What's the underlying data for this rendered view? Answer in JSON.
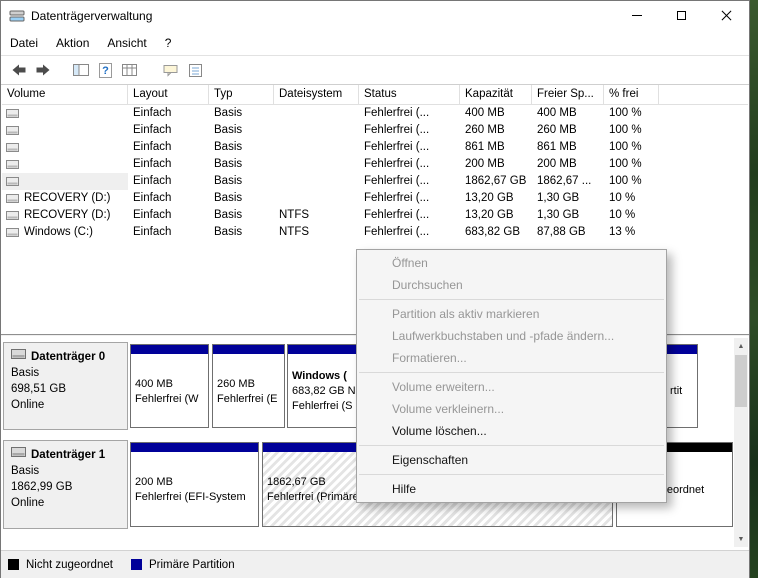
{
  "window": {
    "title": "Datenträgerverwaltung",
    "controls": [
      "minimize",
      "maximize",
      "close"
    ]
  },
  "menubar": [
    "Datei",
    "Aktion",
    "Ansicht",
    "?"
  ],
  "toolbar": {
    "icons": [
      "back",
      "forward",
      "console-tree",
      "help",
      "list-view",
      "action-pane",
      "properties"
    ]
  },
  "table": {
    "columns": [
      "Volume",
      "Layout",
      "Typ",
      "Dateisystem",
      "Status",
      "Kapazität",
      "Freier Sp...",
      "% frei"
    ],
    "rows": [
      [
        "",
        "Einfach",
        "Basis",
        "",
        "Fehlerfrei (...",
        "400 MB",
        "400 MB",
        "100 %"
      ],
      [
        "",
        "Einfach",
        "Basis",
        "",
        "Fehlerfrei (...",
        "260 MB",
        "260 MB",
        "100 %"
      ],
      [
        "",
        "Einfach",
        "Basis",
        "",
        "Fehlerfrei (...",
        "861 MB",
        "861 MB",
        "100 %"
      ],
      [
        "",
        "Einfach",
        "Basis",
        "",
        "Fehlerfrei (...",
        "200 MB",
        "200 MB",
        "100 %"
      ],
      [
        "",
        "Einfach",
        "Basis",
        "",
        "Fehlerfrei (...",
        "1862,67 GB",
        "1862,67 ...",
        "100 %"
      ],
      [
        "RECOVERY (D:)",
        "Einfach",
        "Basis",
        "",
        "Fehlerfrei (...",
        "13,20 GB",
        "1,30 GB",
        "10 %"
      ],
      [
        "RECOVERY (D:)",
        "Einfach",
        "Basis",
        "NTFS",
        "Fehlerfrei (...",
        "13,20 GB",
        "1,30 GB",
        "10 %"
      ],
      [
        "Windows (C:)",
        "Einfach",
        "Basis",
        "NTFS",
        "Fehlerfrei (...",
        "683,82 GB",
        "87,88 GB",
        "13 %"
      ]
    ]
  },
  "context_menu": {
    "items": [
      {
        "label": "Öffnen",
        "enabled": false
      },
      {
        "label": "Durchsuchen",
        "enabled": false
      },
      {
        "type": "separator"
      },
      {
        "label": "Partition als aktiv markieren",
        "enabled": false
      },
      {
        "label": "Laufwerkbuchstaben und -pfade ändern...",
        "enabled": false
      },
      {
        "label": "Formatieren...",
        "enabled": false
      },
      {
        "type": "separator"
      },
      {
        "label": "Volume erweitern...",
        "enabled": false
      },
      {
        "label": "Volume verkleinern...",
        "enabled": false
      },
      {
        "label": "Volume löschen...",
        "enabled": true
      },
      {
        "type": "separator"
      },
      {
        "label": "Eigenschaften",
        "enabled": true
      },
      {
        "type": "separator"
      },
      {
        "label": "Hilfe",
        "enabled": true
      }
    ]
  },
  "disks": [
    {
      "name": "Datenträger 0",
      "type": "Basis",
      "size": "698,51 GB",
      "status": "Online",
      "partitions": [
        {
          "t": "",
          "l1": "400 MB",
          "l2": "Fehlerfrei (W"
        },
        {
          "t": "",
          "l1": "260 MB",
          "l2": "Fehlerfrei (E"
        },
        {
          "t": "Windows (",
          "l1": "683,82 GB N",
          "l2": "Fehlerfrei (S"
        },
        {
          "t": "",
          "l1": "",
          "l2": "rtit"
        }
      ]
    },
    {
      "name": "Datenträger 1",
      "type": "Basis",
      "size": "1862,99 GB",
      "status": "Online",
      "partitions": [
        {
          "t": "",
          "l1": "200 MB",
          "l2": "Fehlerfrei (EFI-System"
        },
        {
          "t": "",
          "l1": "1862,67 GB",
          "l2": "Fehlerfrei (Primäre Partition)"
        },
        {
          "t": "",
          "l1": "",
          "l2": "Nicht zugeordnet"
        }
      ]
    }
  ],
  "legend": [
    {
      "label": "Nicht zugeordnet",
      "color": "#000000"
    },
    {
      "label": "Primäre Partition",
      "color": "#000099"
    }
  ],
  "colors": {
    "primary_partition": "#000099",
    "unallocated": "#000000",
    "disabled_menu_text": "#969696",
    "desktop_background": "#2e4d26"
  }
}
